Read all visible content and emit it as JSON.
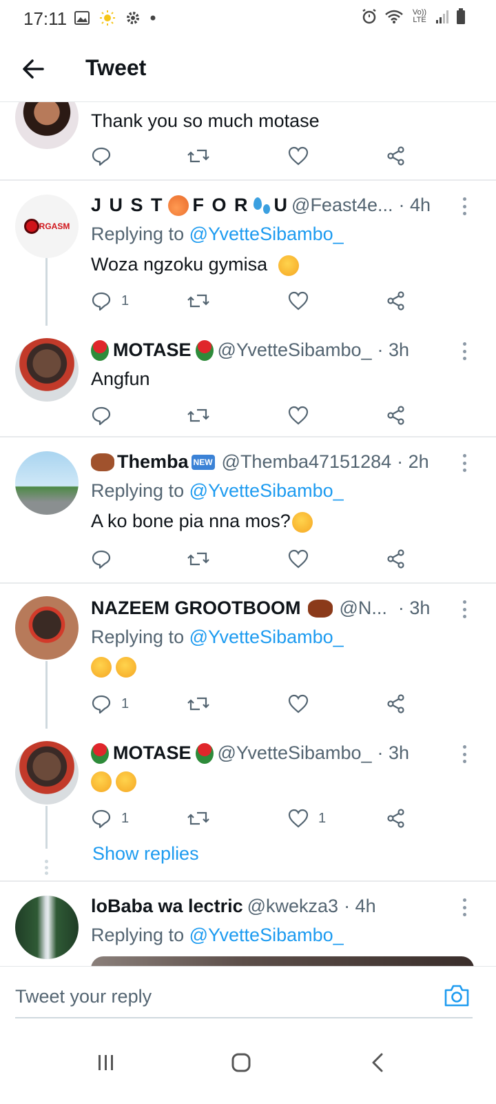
{
  "status_bar": {
    "time": "17:11",
    "lte_label": "Vo)) LTE"
  },
  "header": {
    "title": "Tweet"
  },
  "tweets": [
    {
      "text": "Thank you so much motase",
      "counts": {
        "reply": "",
        "retweet": "",
        "like": ""
      }
    },
    {
      "name": "J U S T",
      "name_mid": "F O R",
      "name_end": "U",
      "handle": "@Feast4e...",
      "time": "· 4h",
      "avatar_text": "RGASM",
      "replying_prefix": "Replying to",
      "replying_to": "@YvetteSibambo_",
      "text": "Woza ngzoku gymisa",
      "counts": {
        "reply": "1",
        "retweet": "",
        "like": ""
      }
    },
    {
      "name": "MOTASE",
      "handle": "@YvetteSibambo_",
      "time": "· 3h",
      "text": "Angfun",
      "counts": {
        "reply": "",
        "retweet": "",
        "like": ""
      }
    },
    {
      "name": "Themba",
      "badge": "NEW",
      "handle": "@Themba47151284",
      "time": "· 2h",
      "replying_prefix": "Replying to",
      "replying_to": "@YvetteSibambo_",
      "text": "A ko bone pia nna mos?",
      "counts": {
        "reply": "",
        "retweet": "",
        "like": ""
      }
    },
    {
      "name": "NAZEEM GROOTBOOM",
      "handle": "@N...",
      "time": "· 3h",
      "replying_prefix": "Replying to",
      "replying_to": "@YvetteSibambo_",
      "counts": {
        "reply": "1",
        "retweet": "",
        "like": ""
      }
    },
    {
      "name": "MOTASE",
      "handle": "@YvetteSibambo_",
      "time": "· 3h",
      "counts": {
        "reply": "1",
        "retweet": "",
        "like": "1"
      }
    },
    {
      "name": "loBaba wa lectric",
      "handle": "@kwekza3",
      "time": "· 4h",
      "replying_prefix": "Replying to",
      "replying_to": "@YvetteSibambo_"
    }
  ],
  "show_replies": "Show replies",
  "reply_bar": {
    "placeholder": "Tweet your reply"
  },
  "colors": {
    "accent": "#1d9bf0",
    "secondary_text": "#536471",
    "primary_text": "#0f1419"
  }
}
